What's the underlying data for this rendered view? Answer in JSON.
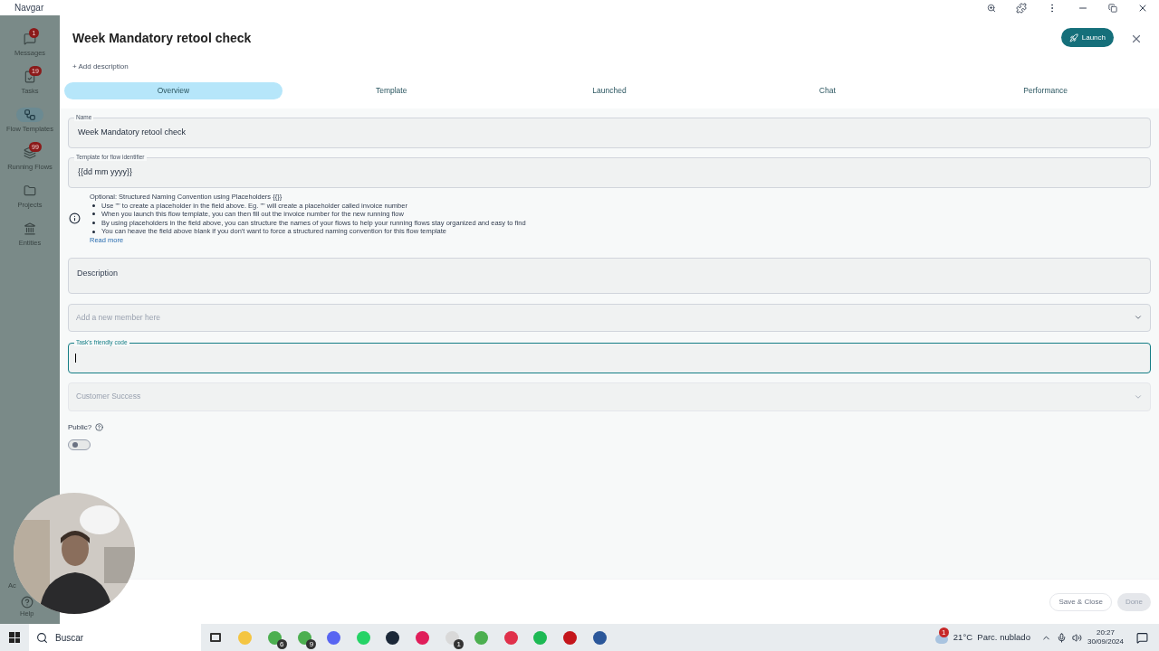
{
  "window": {
    "title": "Navgar"
  },
  "sidebar": {
    "items": [
      {
        "kind": "messages",
        "label": "Messages",
        "badge": "1",
        "selected": false
      },
      {
        "kind": "tasks",
        "label": "Tasks",
        "badge": "19",
        "selected": false
      },
      {
        "kind": "flow",
        "label": "Flow Templates",
        "selected": true
      },
      {
        "kind": "running",
        "label": "Running Flows",
        "badge": "99",
        "selected": false
      },
      {
        "kind": "folder",
        "label": "Projects",
        "selected": false
      },
      {
        "kind": "bank",
        "label": "Entities",
        "selected": false
      }
    ],
    "bottom_items": [
      {
        "kind": "none",
        "label": "Ac"
      },
      {
        "kind": "help",
        "label": "Help"
      }
    ]
  },
  "header": {
    "title": "Week Mandatory retool check",
    "add_description": "+ Add description",
    "launch": "Launch"
  },
  "tabs": [
    {
      "label": "Overview",
      "selected": true
    },
    {
      "label": "Template",
      "selected": false
    },
    {
      "label": "Launched",
      "selected": false
    },
    {
      "label": "Chat",
      "selected": false
    },
    {
      "label": "Performance",
      "selected": false
    }
  ],
  "form": {
    "name": {
      "label": "Name",
      "value": "Week Mandatory retool check"
    },
    "identifier": {
      "label": "Template for flow identifier",
      "value": "{{dd mm yyyy}}"
    },
    "info": {
      "heading": "Optional: Structured Naming Convention using Placeholders {{}}",
      "bullets": [
        "Use \"\" to create a placeholder in the field above. Eg. \"\" will create a placeholder called invoice number",
        "When you launch this flow template, you can then fill out the invoice number for the new running flow",
        "By using placeholders in the field above, you can structure the names of your flows to help your running flows stay organized and easy to find",
        "You can heave the field above blank if you don't want to force a structured naming convention for this flow template"
      ],
      "link": "Read more"
    },
    "description": {
      "placeholder": "Description"
    },
    "member": {
      "placeholder": "Add a new member here"
    },
    "friendly_code": {
      "label": "Task's friendly code",
      "focused": true
    },
    "team": {
      "placeholder": "Customer Success"
    },
    "public": {
      "label": "Public?",
      "on": false
    }
  },
  "footer": {
    "save_close": "Save & Close",
    "done": "Done"
  },
  "taskbar": {
    "search": "Buscar",
    "apps": [
      {
        "kind": "taskview"
      },
      {
        "kind": "folder"
      },
      {
        "kind": "chrome",
        "badge": "6"
      },
      {
        "kind": "chrome",
        "badge": "9"
      },
      {
        "kind": "discord"
      },
      {
        "kind": "whatsapp"
      },
      {
        "kind": "steam"
      },
      {
        "kind": "slack"
      },
      {
        "kind": "app",
        "badge": "1"
      },
      {
        "kind": "chrome"
      },
      {
        "kind": "opera"
      },
      {
        "kind": "spotify"
      },
      {
        "kind": "pdf"
      },
      {
        "kind": "word"
      }
    ],
    "weather": "21°C  Parc. nublado",
    "weather_badge": "1",
    "time": "20:27",
    "date": "30/09/2024"
  }
}
